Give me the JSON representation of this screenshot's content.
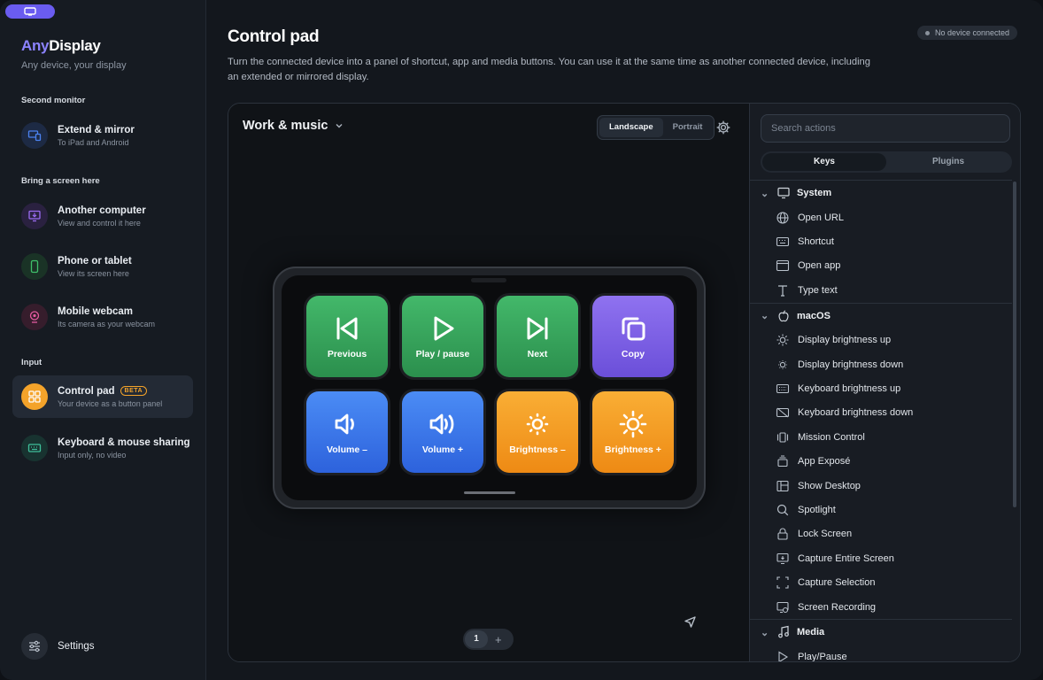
{
  "app": {
    "name_part1": "Any",
    "name_part2": "Display",
    "tagline": "Any device, your display"
  },
  "sidebar": {
    "sections": [
      {
        "label": "Second monitor"
      },
      {
        "label": "Bring a screen here"
      },
      {
        "label": "Input"
      }
    ],
    "items": [
      {
        "title": "Extend & mirror",
        "subtitle": "To iPad and Android",
        "icon": "monitor-tablet-icon",
        "color": "#4b82f0"
      },
      {
        "title": "Another computer",
        "subtitle": "View and control it here",
        "icon": "remote-computer-icon",
        "color": "#9b6cf2"
      },
      {
        "title": "Phone or tablet",
        "subtitle": "View its screen here",
        "icon": "phone-icon",
        "color": "#3fbf6a"
      },
      {
        "title": "Mobile webcam",
        "subtitle": "Its camera as your webcam",
        "icon": "webcam-icon",
        "color": "#e45aa0"
      },
      {
        "title": "Control pad",
        "subtitle": "Your device as a button panel",
        "icon": "grid-icon",
        "color": "#f4a32a",
        "badge": "BETA",
        "active": true
      },
      {
        "title": "Keyboard & mouse sharing",
        "subtitle": "Input only, no video",
        "icon": "keyboard-icon",
        "color": "#3fbf9a"
      }
    ],
    "settings_label": "Settings"
  },
  "header": {
    "title": "Control pad",
    "description": "Turn the connected device into a panel of shortcut, app and media buttons. You can use it at the same time as another connected device, including an extended or mirrored display.",
    "status": "No device connected"
  },
  "canvas": {
    "layout_name": "Work & music",
    "orientation": {
      "options": [
        "Landscape",
        "Portrait"
      ],
      "selected": "Landscape"
    },
    "keys": [
      {
        "label": "Previous",
        "icon": "previous-track-icon",
        "color": "green"
      },
      {
        "label": "Play / pause",
        "icon": "play-icon",
        "color": "green"
      },
      {
        "label": "Next",
        "icon": "next-track-icon",
        "color": "green"
      },
      {
        "label": "Copy",
        "icon": "copy-icon",
        "color": "purple"
      },
      {
        "label": "Volume –",
        "icon": "volume-down-icon",
        "color": "blue"
      },
      {
        "label": "Volume +",
        "icon": "volume-up-icon",
        "color": "blue"
      },
      {
        "label": "Brightness –",
        "icon": "brightness-down-icon",
        "color": "orange"
      },
      {
        "label": "Brightness +",
        "icon": "brightness-up-icon",
        "color": "orange"
      }
    ],
    "page": "1",
    "add_page": "+"
  },
  "actions": {
    "search_placeholder": "Search actions",
    "tabs": [
      "Keys",
      "Plugins"
    ],
    "selected_tab": "Keys",
    "groups": [
      {
        "name": "System",
        "icon": "monitor-icon",
        "items": [
          {
            "label": "Open URL",
            "icon": "globe-icon"
          },
          {
            "label": "Shortcut",
            "icon": "keyboard-icon"
          },
          {
            "label": "Open app",
            "icon": "window-icon"
          },
          {
            "label": "Type text",
            "icon": "text-icon"
          }
        ]
      },
      {
        "name": "macOS",
        "icon": "apple-icon",
        "items": [
          {
            "label": "Display brightness up",
            "icon": "sun-icon"
          },
          {
            "label": "Display brightness down",
            "icon": "sun-small-icon"
          },
          {
            "label": "Keyboard brightness up",
            "icon": "keyboard-light-icon"
          },
          {
            "label": "Keyboard brightness down",
            "icon": "keyboard-dim-icon"
          },
          {
            "label": "Mission Control",
            "icon": "mission-control-icon"
          },
          {
            "label": "App Exposé",
            "icon": "stack-icon"
          },
          {
            "label": "Show Desktop",
            "icon": "desktop-icon"
          },
          {
            "label": "Spotlight",
            "icon": "search-icon"
          },
          {
            "label": "Lock Screen",
            "icon": "lock-icon"
          },
          {
            "label": "Capture Entire Screen",
            "icon": "capture-screen-icon"
          },
          {
            "label": "Capture Selection",
            "icon": "capture-selection-icon"
          },
          {
            "label": "Screen Recording",
            "icon": "screen-record-icon"
          }
        ]
      },
      {
        "name": "Media",
        "icon": "music-note-icon",
        "items": [
          {
            "label": "Play/Pause",
            "icon": "play-icon"
          }
        ]
      }
    ]
  }
}
